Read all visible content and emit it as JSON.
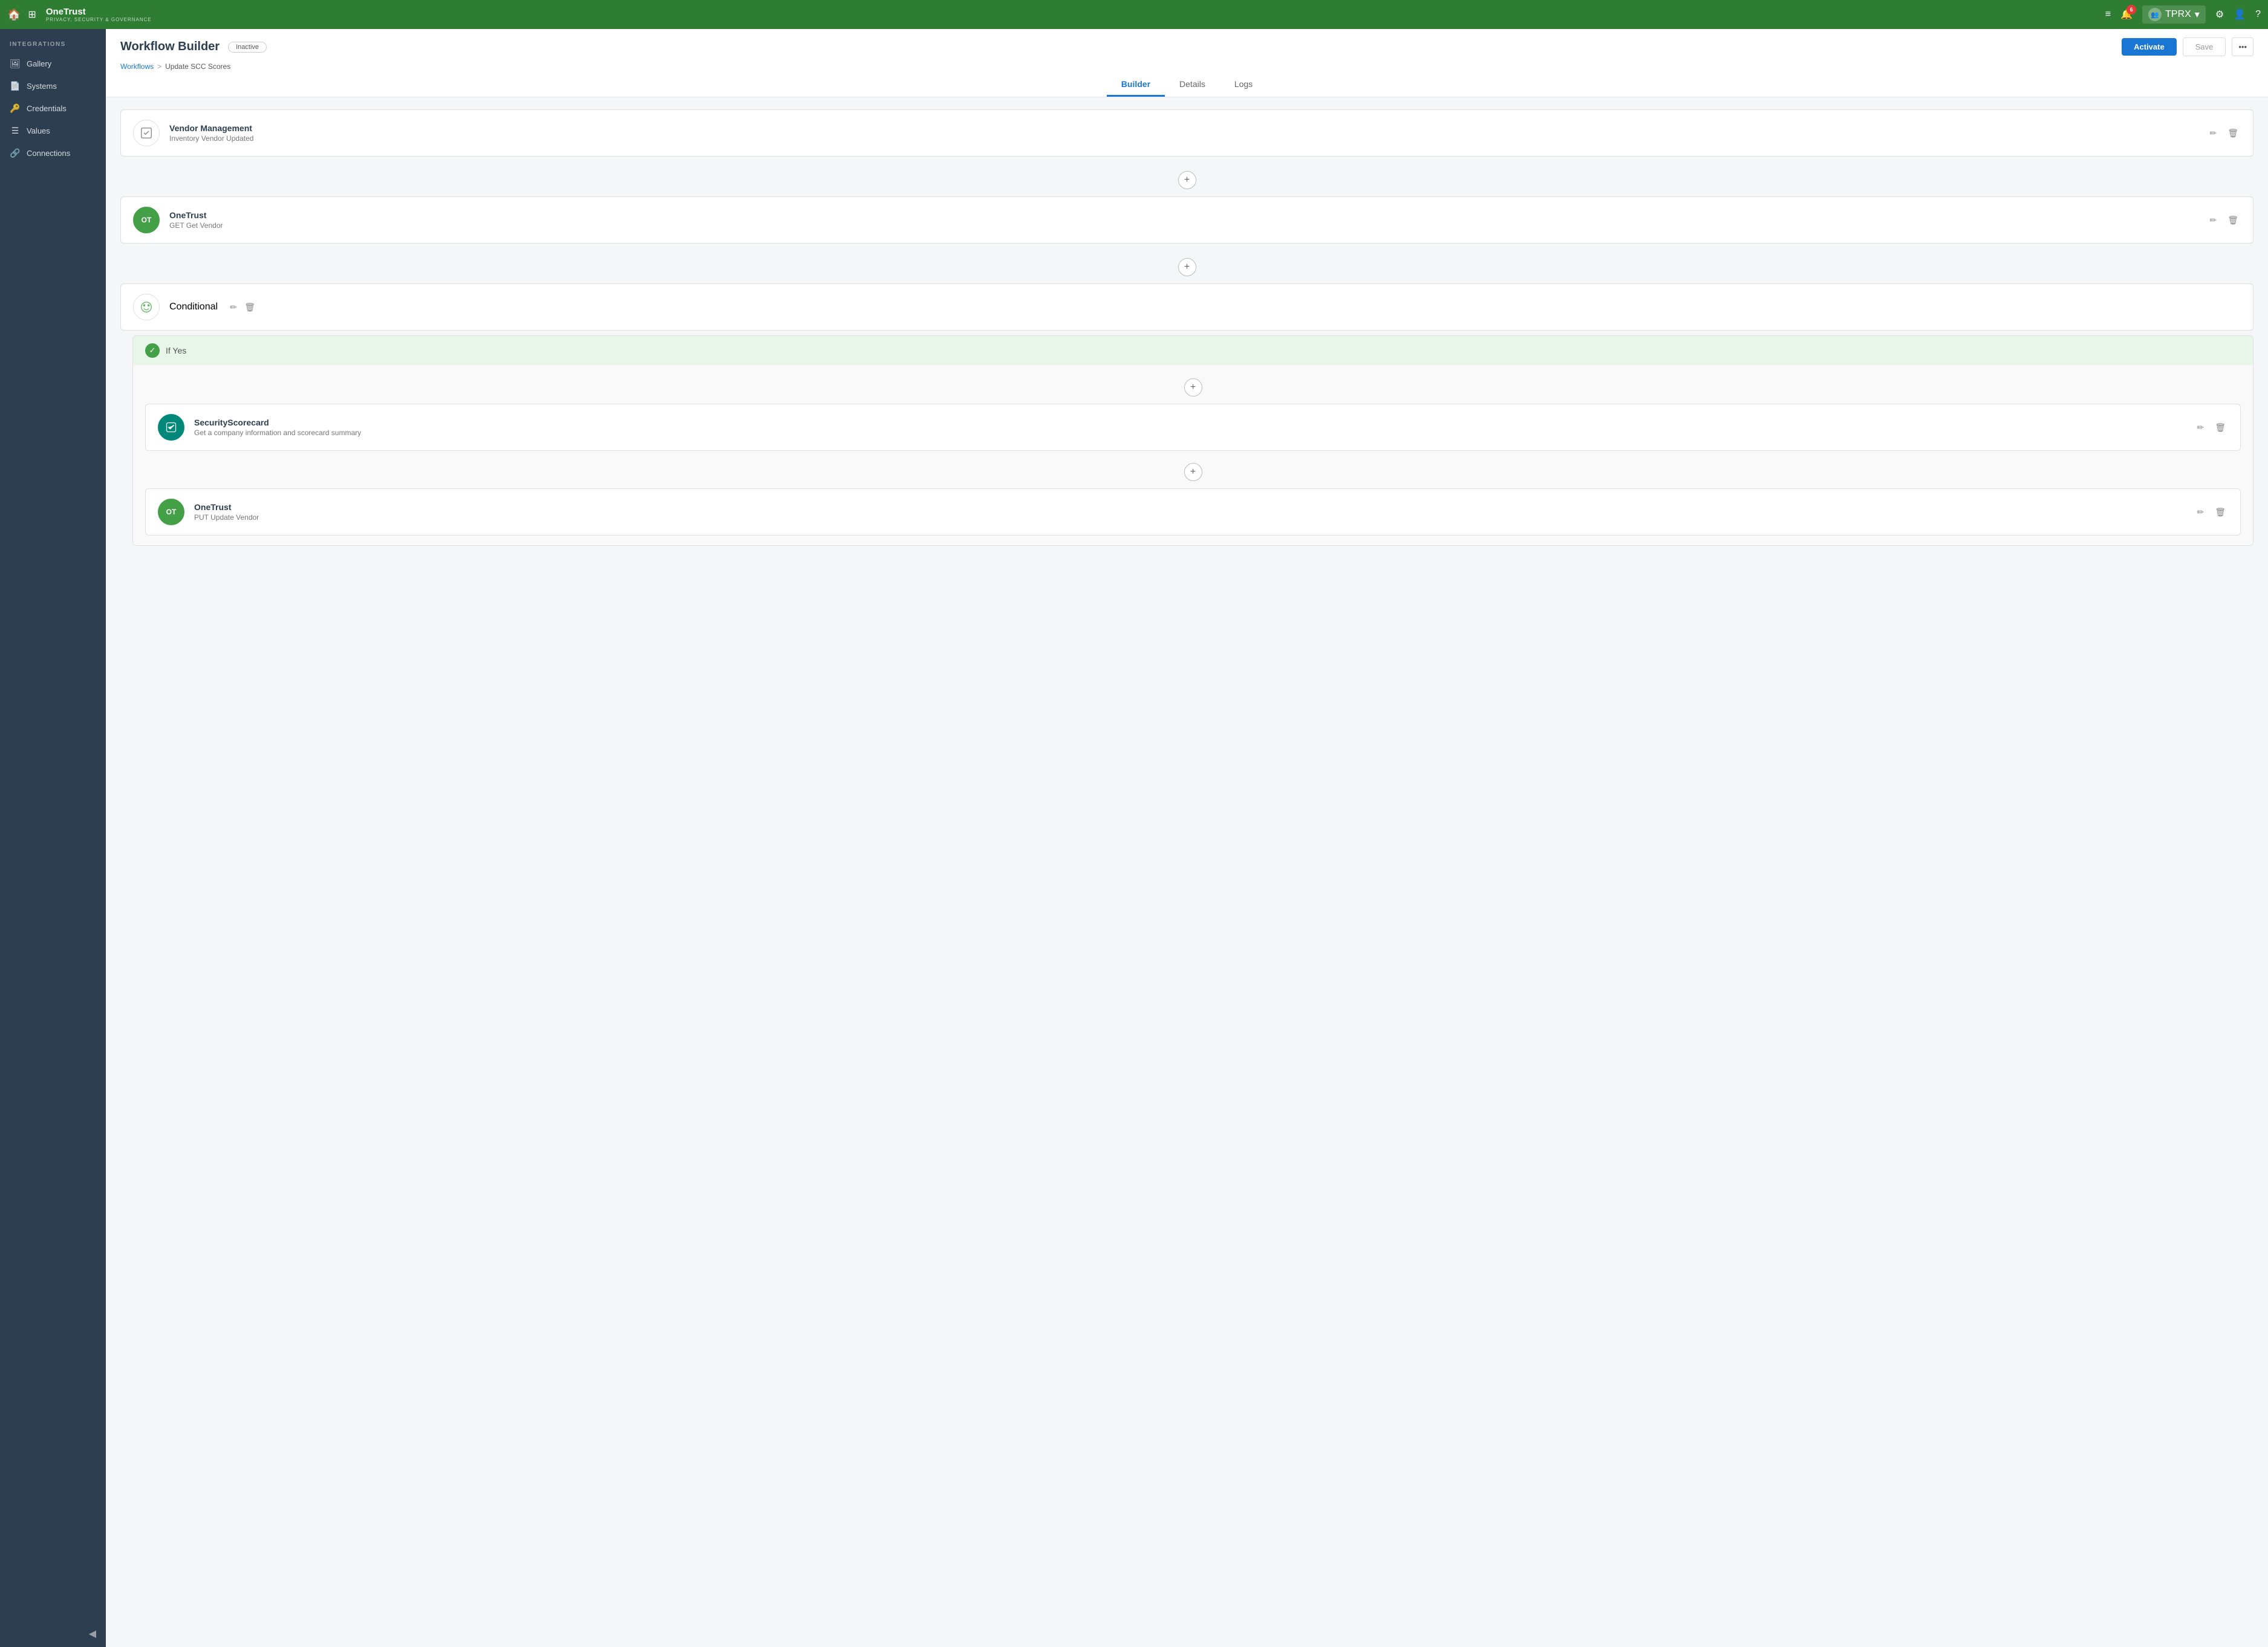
{
  "topnav": {
    "home_label": "🏠",
    "grid_label": "⊞",
    "brand_name": "OneTrust",
    "brand_sub": "PRIVACY, SECURITY & GOVERNANCE",
    "notification_count": "6",
    "user_label": "TPRX",
    "icons": {
      "list": "≡",
      "bell": "🔔",
      "users": "👥",
      "gear": "⚙",
      "person": "👤",
      "help": "?"
    }
  },
  "sidebar": {
    "section_label": "INTEGRATIONS",
    "items": [
      {
        "id": "gallery",
        "icon": "🖼",
        "label": "Gallery"
      },
      {
        "id": "systems",
        "icon": "📄",
        "label": "Systems"
      },
      {
        "id": "credentials",
        "icon": "🔑",
        "label": "Credentials"
      },
      {
        "id": "values",
        "icon": "☰",
        "label": "Values"
      },
      {
        "id": "connections",
        "icon": "🔗",
        "label": "Connections"
      }
    ],
    "collapse_icon": "◀"
  },
  "header": {
    "page_title": "Workflow Builder",
    "status_badge": "Inactive",
    "breadcrumb": {
      "parent": "Workflows",
      "separator": ">",
      "current": "Update SCC Scores"
    },
    "buttons": {
      "activate": "Activate",
      "save": "Save",
      "more": "•••"
    }
  },
  "tabs": [
    {
      "id": "builder",
      "label": "Builder",
      "active": true
    },
    {
      "id": "details",
      "label": "Details",
      "active": false
    },
    {
      "id": "logs",
      "label": "Logs",
      "active": false
    }
  ],
  "workflow": {
    "steps": [
      {
        "id": "step1",
        "type": "vendor-management",
        "icon_type": "box",
        "title": "Vendor Management",
        "subtitle": "Inventory Vendor Updated"
      },
      {
        "id": "step2",
        "type": "onetrust",
        "icon_type": "ot-green",
        "icon_letters": "OT",
        "title": "OneTrust",
        "subtitle": "GET Get Vendor"
      },
      {
        "id": "step3",
        "type": "conditional",
        "icon_type": "conditional",
        "title": "Conditional",
        "subtitle": ""
      }
    ],
    "conditional": {
      "branch_label": "If Yes",
      "branch_steps": [
        {
          "id": "branch-step1",
          "type": "security-scorecard",
          "icon_type": "scorecard",
          "title": "SecurityScorecard",
          "subtitle": "Get a company information and scorecard summary"
        },
        {
          "id": "branch-step2",
          "type": "onetrust",
          "icon_type": "ot-green",
          "icon_letters": "OT",
          "title": "OneTrust",
          "subtitle": "PUT Update Vendor"
        }
      ]
    }
  },
  "colors": {
    "green_accent": "#43a047",
    "blue_primary": "#1976d2",
    "sidebar_bg": "#2c3e50",
    "nav_bg": "#2e7d32"
  }
}
